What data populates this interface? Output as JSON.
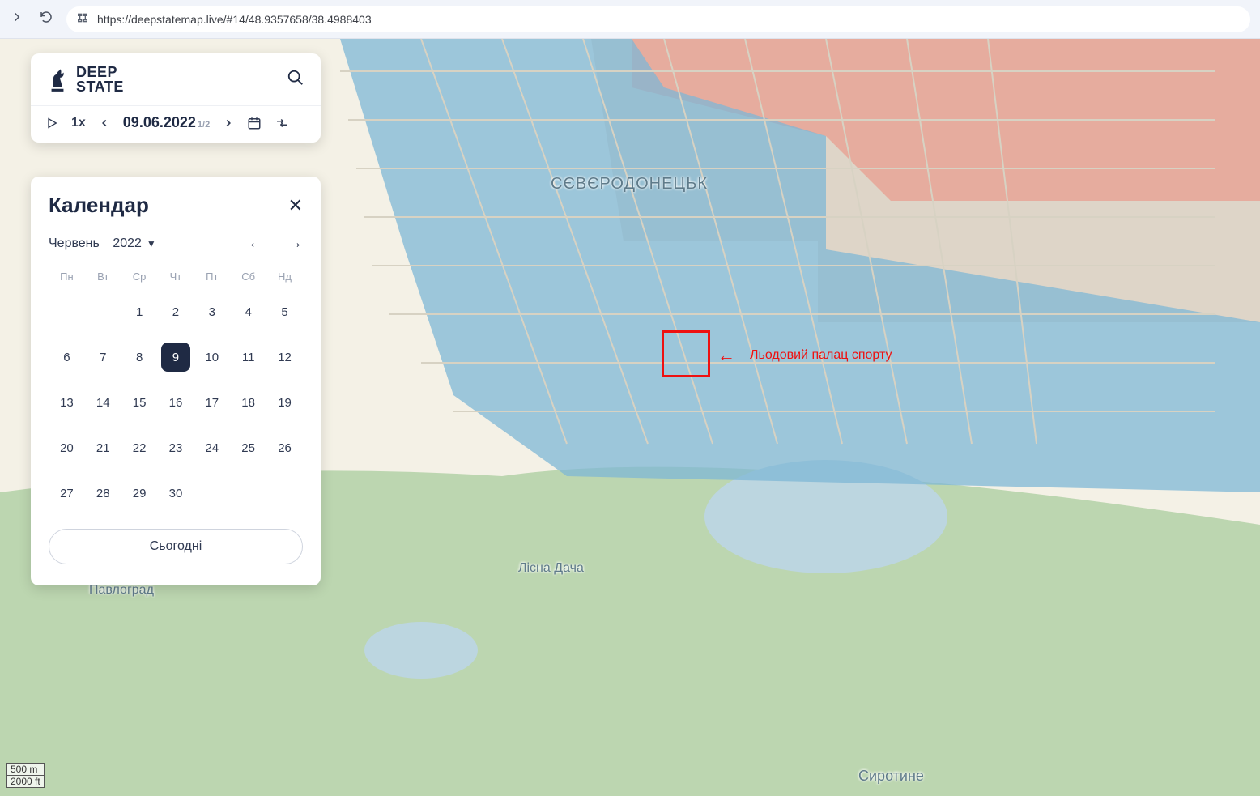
{
  "browser": {
    "url": "https://deepstatemap.live/#14/48.9357658/38.4988403"
  },
  "brand": {
    "line1": "DEEP",
    "line2": "STATE"
  },
  "toolbar": {
    "speed": "1x",
    "date": "09.06.2022",
    "date_fraction": "1/2"
  },
  "calendar": {
    "title": "Календар",
    "month": "Червень",
    "year": "2022",
    "today_label": "Сьогодні",
    "weekdays": [
      "Пн",
      "Вт",
      "Ср",
      "Чт",
      "Пт",
      "Сб",
      "Нд"
    ],
    "first_weekday_index": 2,
    "days_in_month": 30,
    "selected_day": 9
  },
  "map_labels": {
    "city": "СЄВЄРОДОНЕЦЬК",
    "pavlohrad": "Павлоград",
    "lisna_dacha": "Лісна Дача",
    "syrotyne": "Сиротине"
  },
  "annotation": {
    "text": "Льодовий палац спорту"
  },
  "scale": {
    "metric": "500 m",
    "imperial": "2000 ft"
  },
  "colors": {
    "blue_zone": "#7fb7d6",
    "red_zone": "#e7a496",
    "gray_zone": "#d9d0c2",
    "green": "#bcd6b0",
    "water": "#bcd6e0",
    "base": "#f4f1e6"
  }
}
